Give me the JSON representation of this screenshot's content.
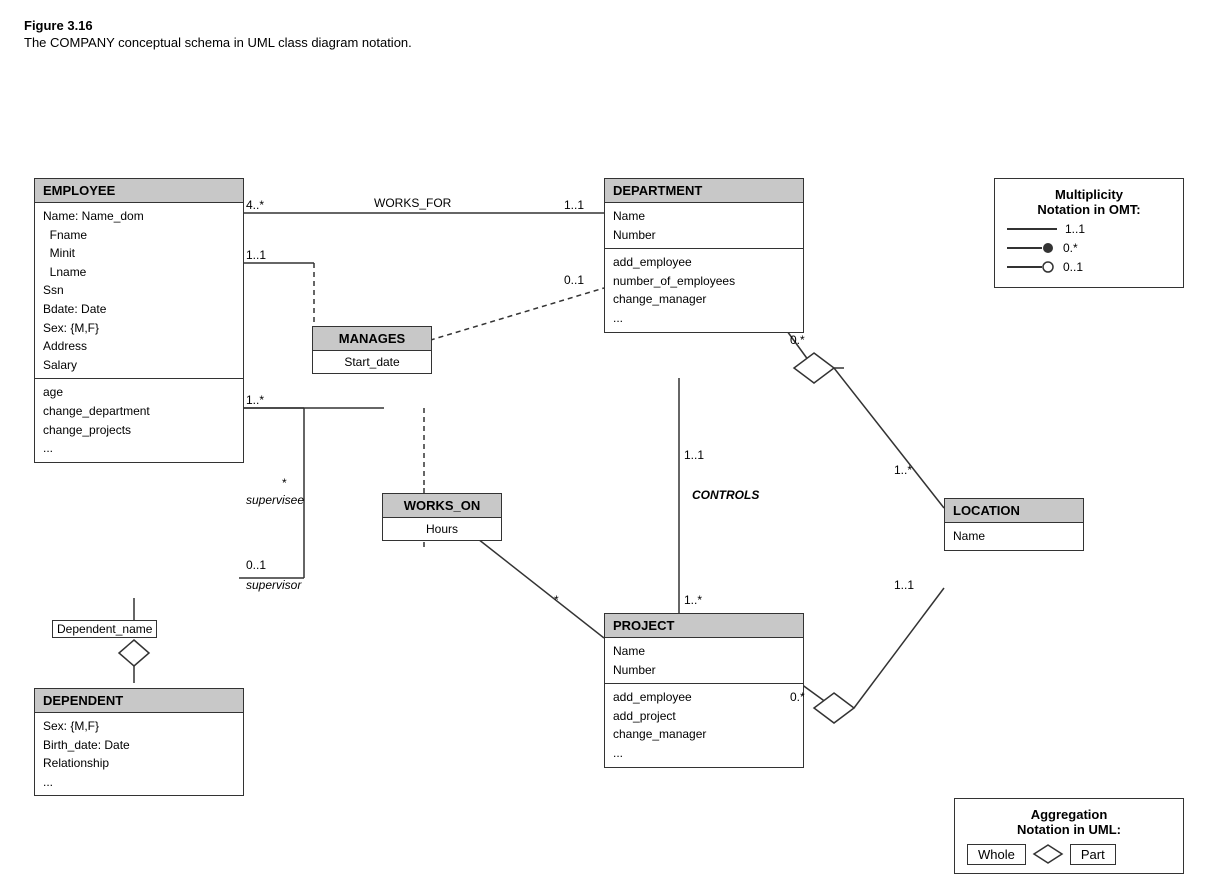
{
  "figure": {
    "title": "Figure 3.16",
    "caption": "The COMPANY conceptual schema in UML class diagram notation."
  },
  "classes": {
    "employee": {
      "name": "EMPLOYEE",
      "attributes": "Name: Name_dom\n  Fname\n  Minit\n  Lname\nSsn\nBdate: Date\nSex: {M,F}\nAddress\nSalary",
      "methods": "age\nchange_department\nchange_projects\n..."
    },
    "department": {
      "name": "DEPARTMENT",
      "attributes": "Name\nNumber",
      "methods": "add_employee\nnumber_of_employees\nchange_manager\n..."
    },
    "project": {
      "name": "PROJECT",
      "attributes": "Name\nNumber",
      "methods": "add_employee\nadd_project\nchange_manager\n..."
    },
    "location": {
      "name": "LOCATION",
      "attributes": "Name"
    },
    "dependent": {
      "name": "DEPENDENT",
      "attributes": "Sex: {M,F}\nBirth_date: Date\nRelationship\n..."
    }
  },
  "assoc_boxes": {
    "manages": {
      "name": "MANAGES",
      "attribute": "Start_date"
    },
    "works_on": {
      "name": "WORKS_ON",
      "attribute": "Hours"
    }
  },
  "labels": {
    "works_for": "WORKS_FOR",
    "controls": "CONTROLS",
    "supervisee": "supervisee",
    "supervisor": "supervisor",
    "dependent_name": "Dependent_name",
    "mult_4star": "4..*",
    "mult_11a": "1..1",
    "mult_11b": "1..1",
    "mult_01": "0..1",
    "mult_1star_a": "1..*",
    "mult_0star_a": "0.*",
    "mult_star_a": "*",
    "mult_01b": "0..1",
    "mult_1star_b": "1..*",
    "mult_star_b": "*",
    "mult_0star_b": "0.*",
    "mult_1star_c": "1..*",
    "mult_11c": "1..1"
  },
  "multiplicity_notation": {
    "title": "Multiplicity\nNotation in OMT:",
    "rows": [
      {
        "symbol": "line",
        "label": "1..1"
      },
      {
        "symbol": "filled-circle",
        "label": "0.*"
      },
      {
        "symbol": "open-circle",
        "label": "0..1"
      }
    ]
  },
  "aggregation_notation": {
    "title": "Aggregation\nNotation in UML:",
    "whole_label": "Whole",
    "part_label": "Part"
  }
}
